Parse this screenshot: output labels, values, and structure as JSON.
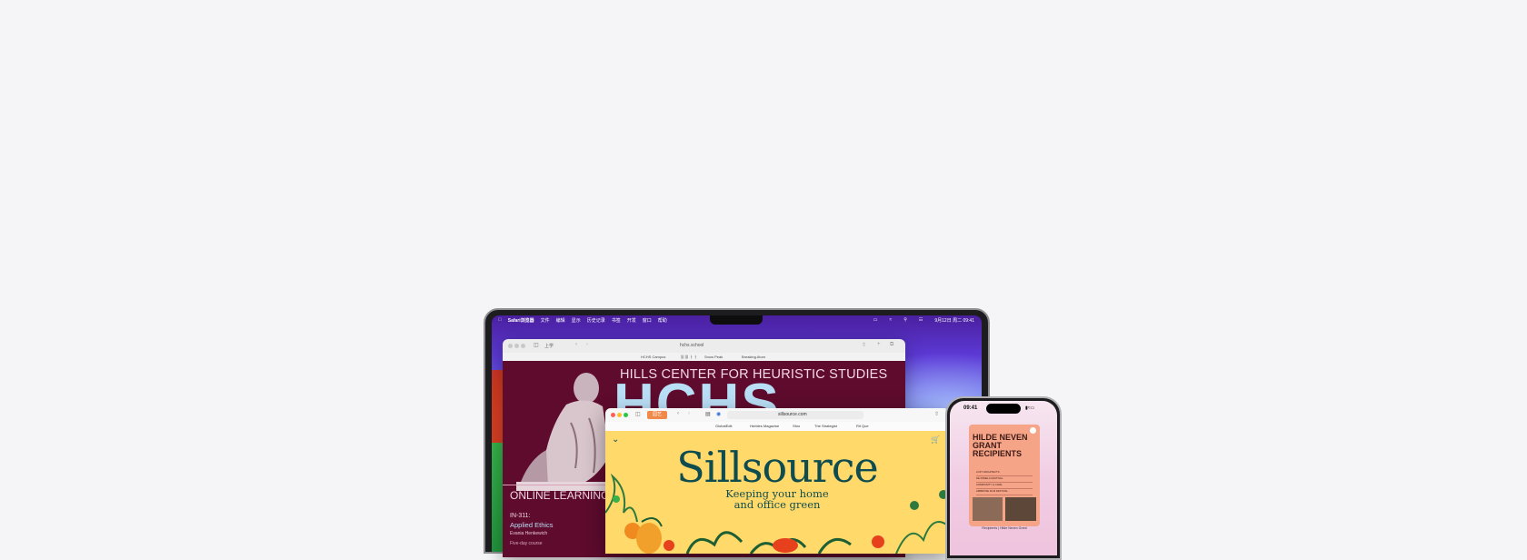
{
  "macbook": {
    "menubar": {
      "items": [
        "Safari浏览器",
        "文件",
        "编辑",
        "显示",
        "历史记录",
        "书签",
        "开发",
        "窗口",
        "帮助"
      ],
      "status": "9月12日 周二 09:41"
    },
    "back_window": {
      "address": "hchs.school",
      "tab_label": "上学",
      "favorites": [
        "HCHS Campus",
        "읽 읽 ㅏ ㅏ",
        "Snow Peak",
        "Breaking Atom"
      ],
      "headline": "HILLS CENTER FOR HEURISTIC STUDIES",
      "big_letters": "HCHS",
      "section": "ONLINE LEARNING",
      "course_code": "IN-311:",
      "course_title": "Applied Ethics",
      "instructor": "Evania Henkewich",
      "duration": "Five-day course"
    },
    "front_window": {
      "address": "sillsource.com",
      "tab_label": "园艺",
      "favorites": [
        "GlobalEdit",
        "Herbles Magazine",
        "Sfoo",
        "The Strategist",
        "Rit Que"
      ],
      "brand": "Sillsource",
      "tagline_line1": "Keeping your home",
      "tagline_line2": "and office green"
    }
  },
  "iphone": {
    "time": "09:41",
    "card_title_line1": "HILDE NEVEN",
    "card_title_line2": "GRANT RECIPIENTS",
    "card_rows": [
      "LOFT ARCHITECTS",
      "DE PAMELA FESTIVAL",
      "COMMUNITY & CARE",
      "AMBROSE FILM FESTIVAL"
    ],
    "caption": "Recipients | Hilde Neven Grant"
  }
}
